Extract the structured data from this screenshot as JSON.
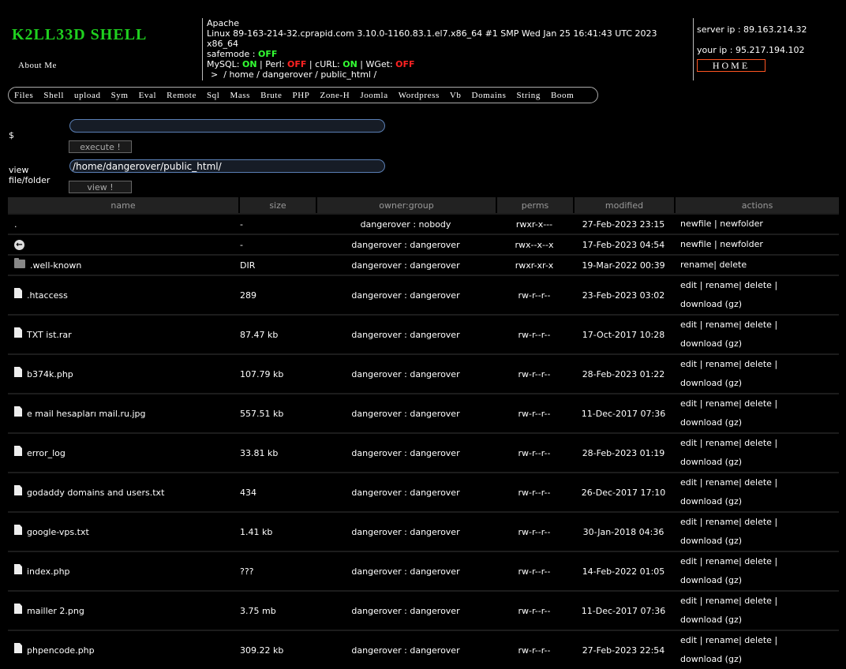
{
  "header": {
    "title": "K2LL33D SHELL",
    "about": "About Me",
    "server": "Apache",
    "uname": "Linux 89-163-214-32.cprapid.com 3.10.0-1160.83.1.el7.x86_64 #1 SMP Wed Jan 25 16:41:43 UTC 2023 x86_64",
    "safemode_label": "safemode :",
    "safemode_value": "OFF",
    "mysql_label": "MySQL:",
    "mysql_value": "ON",
    "perl_label": "Perl:",
    "perl_value": "OFF",
    "curl_label": "cURL:",
    "curl_value": "ON",
    "wget_label": "WGet:",
    "wget_value": "OFF",
    "path_prefix": ">",
    "breadcrumb": [
      "/",
      "home",
      "/",
      "dangerover",
      "/",
      "public_html",
      "/"
    ],
    "server_ip": "server ip : 89.163.214.32",
    "your_ip": "your ip : 95.217.194.102",
    "home_button": "HOME"
  },
  "menu": [
    "Files",
    "Shell",
    "upload",
    "Sym",
    "Eval",
    "Remote",
    "Sql",
    "Mass",
    "Brute",
    "PHP",
    "Zone-H",
    "Joomla",
    "Wordpress",
    "Vb",
    "Domains",
    "String",
    "Boom"
  ],
  "command": {
    "prompt": "$",
    "value": "",
    "execute_label": "execute !"
  },
  "viewer": {
    "label_line1": "view",
    "label_line2": "file/folder",
    "value": "/home/dangerover/public_html/",
    "view_label": "view !"
  },
  "table": {
    "headers": [
      "name",
      "size",
      "owner:group",
      "perms",
      "modified",
      "actions"
    ],
    "rows": [
      {
        "icon": "none",
        "name": ".",
        "size": "-",
        "owner": "dangerover : nobody",
        "perms": "rwxr-x---",
        "modified": "27-Feb-2023 23:15",
        "actions": [
          "newfile",
          "|",
          "newfolder"
        ]
      },
      {
        "icon": "back-icon",
        "name": "",
        "size": "-",
        "owner": "dangerover : dangerover",
        "perms": "rwx--x--x",
        "modified": "17-Feb-2023 04:54",
        "actions": [
          "newfile",
          "|",
          "newfolder"
        ]
      },
      {
        "icon": "folder-icon",
        "name": ".well-known",
        "size": "DIR",
        "owner": "dangerover : dangerover",
        "perms": "rwxr-xr-x",
        "modified": "19-Mar-2022 00:39",
        "actions": [
          "rename|",
          "delete"
        ]
      },
      {
        "icon": "file-icon",
        "name": ".htaccess",
        "size": "289",
        "owner": "dangerover : dangerover",
        "perms": "rw-r--r--",
        "modified": "23-Feb-2023 03:02",
        "actions": [
          "edit",
          "|",
          "rename|",
          "delete",
          "|",
          "download (gz)"
        ]
      },
      {
        "icon": "file-icon",
        "name": "TXT ist.rar",
        "size": "87.47 kb",
        "owner": "dangerover : dangerover",
        "perms": "rw-r--r--",
        "modified": "17-Oct-2017 10:28",
        "actions": [
          "edit",
          "|",
          "rename|",
          "delete",
          "|",
          "download (gz)"
        ]
      },
      {
        "icon": "file-icon",
        "name": "b374k.php",
        "size": "107.79 kb",
        "owner": "dangerover : dangerover",
        "perms": "rw-r--r--",
        "modified": "28-Feb-2023 01:22",
        "actions": [
          "edit",
          "|",
          "rename|",
          "delete",
          "|",
          "download (gz)"
        ]
      },
      {
        "icon": "file-icon",
        "name": "e mail hesapları mail.ru.jpg",
        "size": "557.51 kb",
        "owner": "dangerover : dangerover",
        "perms": "rw-r--r--",
        "modified": "11-Dec-2017 07:36",
        "actions": [
          "edit",
          "|",
          "rename|",
          "delete",
          "|",
          "download (gz)"
        ]
      },
      {
        "icon": "file-icon",
        "name": "error_log",
        "size": "33.81 kb",
        "owner": "dangerover : dangerover",
        "perms": "rw-r--r--",
        "modified": "28-Feb-2023 01:19",
        "actions": [
          "edit",
          "|",
          "rename|",
          "delete",
          "|",
          "download (gz)"
        ]
      },
      {
        "icon": "file-icon",
        "name": "godaddy domains and users.txt",
        "size": "434",
        "owner": "dangerover : dangerover",
        "perms": "rw-r--r--",
        "modified": "26-Dec-2017 17:10",
        "actions": [
          "edit",
          "|",
          "rename|",
          "delete",
          "|",
          "download (gz)"
        ]
      },
      {
        "icon": "file-icon",
        "name": "google-vps.txt",
        "size": "1.41 kb",
        "owner": "dangerover : dangerover",
        "perms": "rw-r--r--",
        "modified": "30-Jan-2018 04:36",
        "actions": [
          "edit",
          "|",
          "rename|",
          "delete",
          "|",
          "download (gz)"
        ]
      },
      {
        "icon": "file-icon",
        "name": "index.php",
        "size": "???",
        "owner": "dangerover : dangerover",
        "perms": "rw-r--r--",
        "modified": "14-Feb-2022 01:05",
        "actions": [
          "edit",
          "|",
          "rename|",
          "delete",
          "|",
          "download (gz)"
        ]
      },
      {
        "icon": "file-icon",
        "name": "mailler 2.png",
        "size": "3.75 mb",
        "owner": "dangerover : dangerover",
        "perms": "rw-r--r--",
        "modified": "11-Dec-2017 07:36",
        "actions": [
          "edit",
          "|",
          "rename|",
          "delete",
          "|",
          "download (gz)"
        ]
      },
      {
        "icon": "file-icon",
        "name": "phpencode.php",
        "size": "309.22 kb",
        "owner": "dangerover : dangerover",
        "perms": "rw-r--r--",
        "modified": "27-Feb-2023 22:54",
        "actions": [
          "edit",
          "|",
          "rename|",
          "delete",
          "|",
          "download (gz)"
        ]
      }
    ]
  },
  "colors": {
    "on": "#33ff33",
    "off": "#ff2222",
    "title": "#1fd01f",
    "home_border": "#ff5522"
  }
}
